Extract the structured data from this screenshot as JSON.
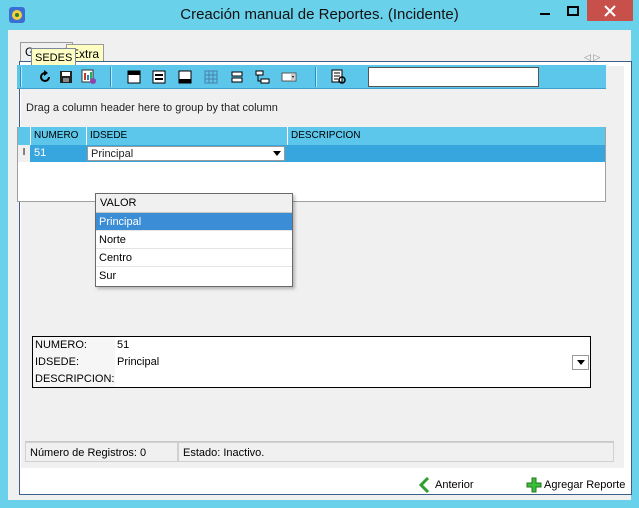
{
  "window": {
    "title": "Creación manual de Reportes. (Incidente)"
  },
  "tabs": [
    {
      "label": "General"
    },
    {
      "label": "Extra"
    }
  ],
  "inner_tab": {
    "label": "SEDES"
  },
  "group_hint": "Drag a column header here to group by that column",
  "grid": {
    "columns": [
      "NUMERO",
      "IDSEDE",
      "DESCRIPCION"
    ],
    "row": {
      "numero": "51",
      "idsede": "Principal",
      "descripcion": "",
      "indicator": "I"
    }
  },
  "dropdown": {
    "header": "VALOR",
    "items": [
      "Principal",
      "Norte",
      "Centro",
      "Sur"
    ],
    "selected": "Principal"
  },
  "detail": {
    "numero_label": "NUMERO:",
    "numero_value": "51",
    "idsede_label": "IDSEDE:",
    "idsede_value": "Principal",
    "descripcion_label": "DESCRIPCION:",
    "descripcion_value": ""
  },
  "status": {
    "registros": "Número de Registros: 0",
    "estado": "Estado: Inactivo."
  },
  "footer": {
    "anterior": "Anterior",
    "agregar": "Agregar Reporte"
  },
  "colors": {
    "titlebar": "#6ad1ea",
    "toolbar": "#5cc6eb",
    "selected_row": "#38a6de",
    "close_button": "#c7504a",
    "tab_active": "#ffffc4"
  }
}
